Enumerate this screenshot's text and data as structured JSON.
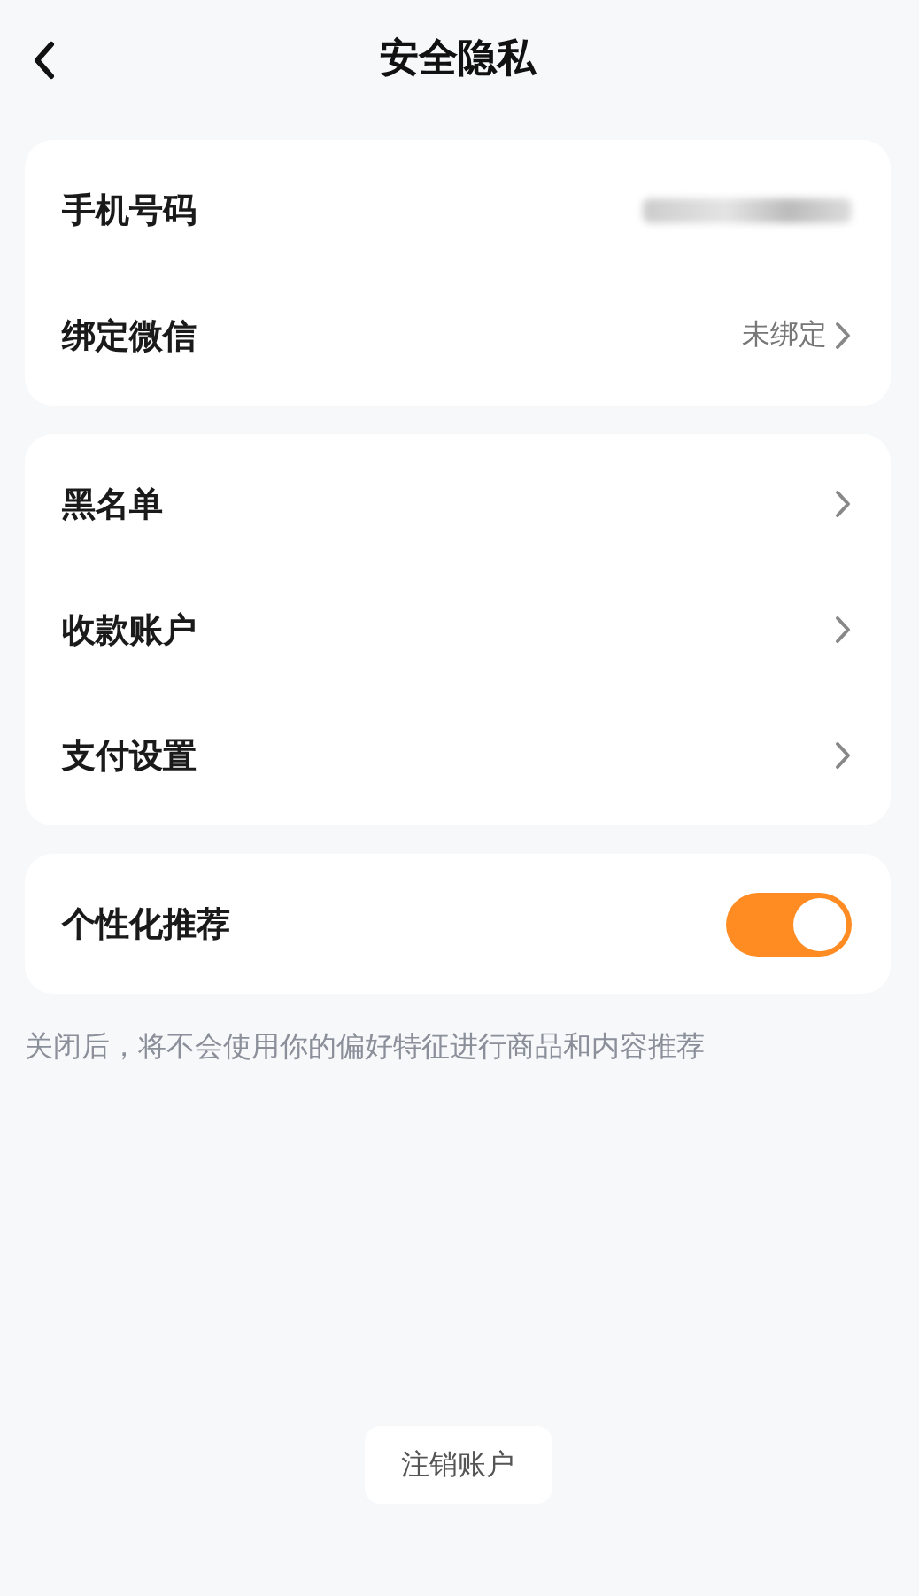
{
  "header": {
    "title": "安全隐私"
  },
  "groups": [
    {
      "rows": [
        {
          "kind": "masked",
          "label": "手机号码"
        },
        {
          "kind": "link",
          "label": "绑定微信",
          "value": "未绑定"
        }
      ]
    },
    {
      "rows": [
        {
          "kind": "link",
          "label": "黑名单"
        },
        {
          "kind": "link",
          "label": "收款账户"
        },
        {
          "kind": "link",
          "label": "支付设置"
        }
      ]
    },
    {
      "rows": [
        {
          "kind": "toggle",
          "label": "个性化推荐",
          "on": true
        }
      ]
    }
  ],
  "note": "关闭后，将不会使用你的偏好特征进行商品和内容推荐",
  "footer_button": "注销账户"
}
